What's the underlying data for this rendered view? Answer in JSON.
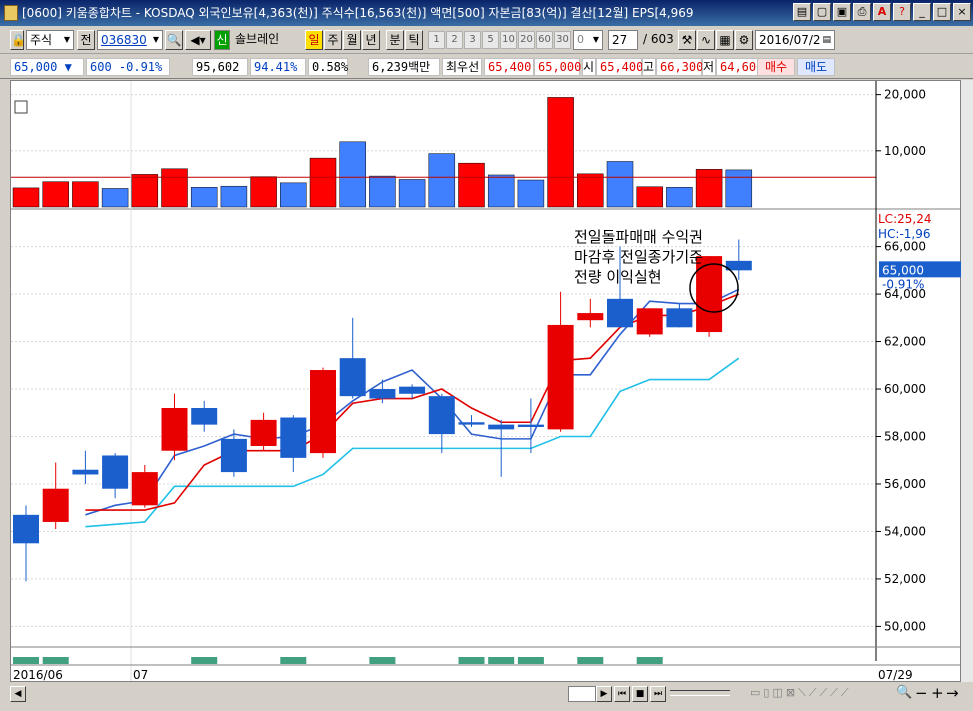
{
  "title": "[0600] 키움종합차트 - KOSDAQ 외국인보유[4,363(천)] 주식수[16,563(천)] 액면[500] 자본금[83(억)] 결산[12월] EPS[4,969",
  "toolbar": {
    "type_label": "주식",
    "all_label": "전",
    "code": "036830",
    "stock_name": "솔브레인",
    "periods": [
      "일",
      "주",
      "월",
      "년",
      "분",
      "틱"
    ],
    "numbers": [
      "1",
      "2",
      "3",
      "5",
      "10",
      "20",
      "60",
      "30",
      "0"
    ],
    "count": "27",
    "total": "/ 603",
    "date": "2016/07/2"
  },
  "info": {
    "price": "65,000 ▼",
    "change": "600 -0.91%",
    "volume": "95,602",
    "vol_ratio": "94.41%",
    "turnover": "0.58%",
    "amount": "6,239백만",
    "best_label": "최우선",
    "best_ask": "65,400",
    "best_bid": "65,000",
    "open_label": "시",
    "open": "65,400",
    "high_label": "고",
    "high": "66,300",
    "low_label": "저",
    "low": "64,600",
    "buy_label": "매수",
    "sell_label": "매도"
  },
  "annotation": {
    "line1": "전일돌파매매 수익권",
    "line2": "마감후 전일종가기준",
    "line3": "전량 이익실현"
  },
  "price_panel": {
    "lc": "LC:25,24",
    "hc": "HC:-1,96",
    "current": "65,000",
    "current_change": "-0.91%"
  },
  "x_labels": {
    "start": "2016/06",
    "mid": "07",
    "end": "07/29"
  },
  "colors": {
    "up": "#e80000",
    "down": "#1a5fcc",
    "vol_up": "#ff0000",
    "vol_down": "#4080ff",
    "ma_red": "#e00000",
    "ma_blue": "#3060d0",
    "ma_cyan": "#20c0e8"
  },
  "chart_data": [
    {
      "type": "bar",
      "title": "",
      "yticks": [
        10000,
        20000
      ],
      "ylim": [
        0,
        21000
      ],
      "values": [
        3400,
        4500,
        4500,
        3300,
        5800,
        6800,
        3500,
        3700,
        5400,
        4300,
        8700,
        11600,
        5500,
        4900,
        9500,
        7800,
        5700,
        4800,
        19500,
        5900,
        8100,
        3600,
        3500,
        6700,
        6600
      ],
      "directions": [
        "up",
        "up",
        "up",
        "down",
        "up",
        "up",
        "down",
        "down",
        "up",
        "down",
        "up",
        "down",
        "down",
        "down",
        "down",
        "up",
        "down",
        "down",
        "up",
        "up",
        "down",
        "up",
        "down",
        "up",
        "down"
      ],
      "moving_average": 5300
    },
    {
      "type": "candlestick",
      "title": "",
      "yticks": [
        50000,
        52000,
        54000,
        56000,
        58000,
        60000,
        62000,
        64000,
        66000
      ],
      "ylim": [
        49300,
        67500
      ],
      "candles": [
        {
          "open": 54700,
          "high": 55100,
          "low": 51900,
          "close": 53500
        },
        {
          "open": 54400,
          "high": 56900,
          "low": 54100,
          "close": 55800
        },
        {
          "open": 56600,
          "high": 57400,
          "low": 56000,
          "close": 56400
        },
        {
          "open": 57200,
          "high": 57300,
          "low": 55400,
          "close": 55800
        },
        {
          "open": 55100,
          "high": 56800,
          "low": 55000,
          "close": 56500
        },
        {
          "open": 57400,
          "high": 59800,
          "low": 57000,
          "close": 59200
        },
        {
          "open": 59200,
          "high": 59500,
          "low": 58200,
          "close": 58500
        },
        {
          "open": 57900,
          "high": 58300,
          "low": 56300,
          "close": 56500
        },
        {
          "open": 57600,
          "high": 59000,
          "low": 57400,
          "close": 58700
        },
        {
          "open": 58800,
          "high": 58900,
          "low": 56500,
          "close": 57100
        },
        {
          "open": 57300,
          "high": 60900,
          "low": 57100,
          "close": 60800
        },
        {
          "open": 61300,
          "high": 63000,
          "low": 59600,
          "close": 59700
        },
        {
          "open": 60000,
          "high": 60400,
          "low": 59400,
          "close": 59600
        },
        {
          "open": 60100,
          "high": 60200,
          "low": 59600,
          "close": 59800
        },
        {
          "open": 59700,
          "high": 59800,
          "low": 57300,
          "close": 58100
        },
        {
          "open": 58600,
          "high": 58900,
          "low": 58400,
          "close": 58500
        },
        {
          "open": 58500,
          "high": 58700,
          "low": 56300,
          "close": 58300
        },
        {
          "open": 58500,
          "high": 59600,
          "low": 57300,
          "close": 58400
        },
        {
          "open": 58300,
          "high": 64100,
          "low": 58200,
          "close": 62700
        },
        {
          "open": 62900,
          "high": 63800,
          "low": 62600,
          "close": 63200
        },
        {
          "open": 63800,
          "high": 66000,
          "low": 62600,
          "close": 62600
        },
        {
          "open": 62300,
          "high": 63400,
          "low": 62200,
          "close": 63400
        },
        {
          "open": 63400,
          "high": 63600,
          "low": 62600,
          "close": 62600
        },
        {
          "open": 62400,
          "high": 65600,
          "low": 62200,
          "close": 65600
        },
        {
          "open": 65400,
          "high": 66300,
          "low": 64600,
          "close": 65000
        }
      ],
      "ma_red": [
        null,
        null,
        54900,
        54900,
        54900,
        55200,
        56800,
        57400,
        57400,
        57400,
        58100,
        59400,
        59600,
        59600,
        60000,
        59200,
        58600,
        58600,
        61200,
        61300,
        62600,
        63100,
        63100,
        63500,
        64000
      ],
      "ma_blue": [
        null,
        null,
        54700,
        55100,
        55300,
        57200,
        57600,
        58100,
        57900,
        58000,
        58500,
        59500,
        60300,
        60800,
        59600,
        58100,
        57900,
        57900,
        60600,
        60600,
        62300,
        63700,
        63600,
        63600,
        64200
      ],
      "ma_cyan": [
        null,
        null,
        54200,
        54300,
        54400,
        55900,
        55900,
        55900,
        55900,
        55900,
        56400,
        57500,
        57500,
        57500,
        57500,
        57500,
        57500,
        57500,
        58000,
        58000,
        59900,
        60400,
        60400,
        60400,
        61300
      ]
    },
    {
      "type": "bar",
      "title": "",
      "values": [
        1,
        1,
        0,
        0,
        0,
        0,
        1,
        0,
        0,
        1,
        0,
        0,
        1,
        0,
        0,
        1,
        1,
        1,
        0,
        1,
        0,
        1,
        0,
        0,
        0
      ]
    }
  ]
}
